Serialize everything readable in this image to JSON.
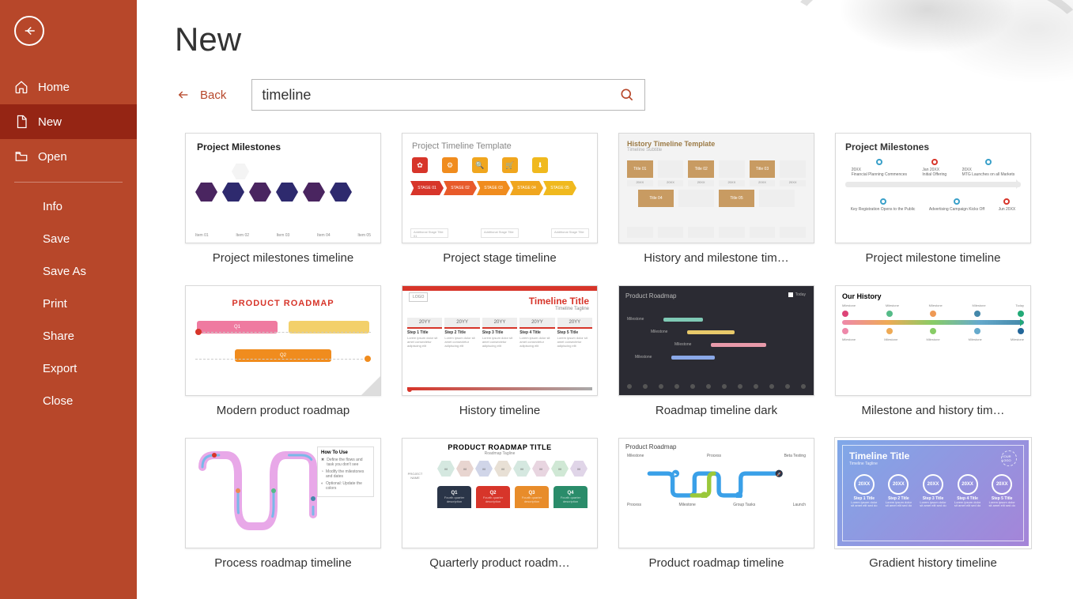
{
  "page": {
    "title": "New"
  },
  "back": {
    "label": "Back"
  },
  "search": {
    "value": "timeline"
  },
  "sidebar": {
    "nav": [
      {
        "key": "home",
        "label": "Home"
      },
      {
        "key": "new",
        "label": "New"
      },
      {
        "key": "open",
        "label": "Open"
      }
    ],
    "secondary": [
      {
        "key": "info",
        "label": "Info"
      },
      {
        "key": "save",
        "label": "Save"
      },
      {
        "key": "saveas",
        "label": "Save As"
      },
      {
        "key": "print",
        "label": "Print"
      },
      {
        "key": "share",
        "label": "Share"
      },
      {
        "key": "export",
        "label": "Export"
      },
      {
        "key": "close",
        "label": "Close"
      }
    ]
  },
  "templates": [
    {
      "id": "project-milestones-timeline",
      "caption": "Project milestones timeline",
      "thumb": {
        "title": "Project Milestones"
      }
    },
    {
      "id": "project-stage-timeline",
      "caption": "Project stage timeline",
      "thumb": {
        "title_a": "Project Timeline",
        "title_b": " Template",
        "stages": [
          "STAGE 01",
          "STAGE 02",
          "STAGE 03",
          "STAGE 04",
          "STAGE 05"
        ],
        "foot": [
          "Additional Stage Title 01",
          "Additional Stage Title",
          "Additional Stage Title"
        ]
      }
    },
    {
      "id": "history-and-milestone-timeline",
      "caption": "History and milestone tim…",
      "thumb": {
        "title": "History Timeline Template",
        "subtitle": "Timeline Subtitle",
        "labels": [
          "Title 01",
          "20XX",
          "Title 02",
          "20XX",
          "Title 03",
          "20XX",
          "20XX",
          "20XX",
          "20XX"
        ]
      }
    },
    {
      "id": "project-milestone-timeline",
      "caption": "Project milestone timeline",
      "thumb": {
        "title": "Project Milestones"
      }
    },
    {
      "id": "modern-product-roadmap",
      "caption": "Modern product roadmap",
      "thumb": {
        "title": "PRODUCT ROADMAP",
        "bars": [
          "Q1",
          "",
          "Q2"
        ]
      }
    },
    {
      "id": "history-timeline",
      "caption": "History timeline",
      "thumb": {
        "logo": "LOGO",
        "title": "Timeline Title",
        "subtitle": "Timeline Tagline",
        "years": [
          "20YY",
          "20YY",
          "20YY",
          "20YY",
          "20YY"
        ],
        "steps": [
          "Step 1 Title",
          "Step 2 Title",
          "Step 3 Title",
          "Step 4 Title",
          "Step 5 Title"
        ]
      }
    },
    {
      "id": "roadmap-timeline-dark",
      "caption": "Roadmap timeline dark",
      "thumb": {
        "title": "Product Roadmap",
        "today": "Today",
        "items": [
          "Milestone",
          "Milestone",
          "Milestone",
          "Milestone",
          "Milestone"
        ]
      }
    },
    {
      "id": "milestone-and-history-timeline",
      "caption": "Milestone and history tim…",
      "thumb": {
        "title": "Our History",
        "cats": [
          "Milestone",
          "Milestone",
          "Milestone",
          "Milestone",
          "Today"
        ]
      }
    },
    {
      "id": "process-roadmap-timeline",
      "caption": "Process roadmap timeline",
      "thumb": {
        "howto": "How To Use",
        "items": [
          "Define the flows and task you don't see",
          "Modify the milestones and dates",
          "Optional: Update the colors"
        ]
      }
    },
    {
      "id": "quarterly-product-roadmap",
      "caption": "Quarterly product roadm…",
      "thumb": {
        "title": "PRODUCT ROADMAP TITLE",
        "subtitle": "Roadmap Tagline",
        "side": "PROJECT NAME",
        "q": [
          "Q1",
          "Q2",
          "Q3",
          "Q4"
        ]
      }
    },
    {
      "id": "product-roadmap-timeline",
      "caption": "Product roadmap timeline",
      "thumb": {
        "title": "Product Roadmap",
        "top": [
          "Milestone",
          "Process",
          "Beta Testing"
        ],
        "bottom": [
          "Process",
          "Milestone",
          "Group Tasks",
          "Launch"
        ]
      }
    },
    {
      "id": "gradient-history-timeline",
      "caption": "Gradient history timeline",
      "thumb": {
        "title": "Timeline Title",
        "subtitle": "Timeline Tagline",
        "logo": "YOUR LOGO",
        "years": [
          "20XX",
          "20XX",
          "20XX",
          "20XX",
          "20XX"
        ],
        "steps": [
          "Step 1 Title",
          "Step 2 Title",
          "Step 3 Title",
          "Step 4 Title",
          "Step 5 Title"
        ],
        "desc": "Lorem ipsum dolor sit amet elit sed do"
      }
    }
  ],
  "colors": {
    "accent": "#b7472a"
  }
}
